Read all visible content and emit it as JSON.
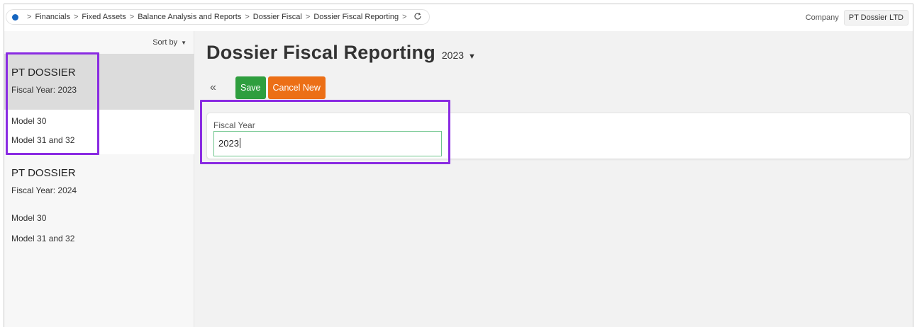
{
  "breadcrumbs": [
    "Financials",
    "Fixed Assets",
    "Balance Analysis and Reports",
    "Dossier Fiscal",
    "Dossier Fiscal Reporting"
  ],
  "breadcrumb_separator": ">",
  "company": {
    "label": "Company",
    "value": "PT Dossier LTD"
  },
  "sidebar": {
    "sort_label": "Sort by",
    "groups": [
      {
        "title": "PT DOSSIER",
        "fiscal_label": "Fiscal Year:",
        "fiscal_value": "2023",
        "items": [
          "Model 30",
          "Model 31 and 32"
        ]
      },
      {
        "title": "PT DOSSIER",
        "fiscal_label": "Fiscal Year:",
        "fiscal_value": "2024",
        "items": [
          "Model 30",
          "Model 31 and 32"
        ]
      }
    ]
  },
  "page": {
    "title": "Dossier Fiscal Reporting",
    "year": "2023"
  },
  "toolbar": {
    "collapse_symbol": "«",
    "save_label": "Save",
    "cancel_label": "Cancel New"
  },
  "form": {
    "fiscal_year_label": "Fiscal Year",
    "fiscal_year_value": "2023"
  },
  "colors": {
    "save": "#2e9e3e",
    "cancel": "#ec6f16",
    "highlight": "#8a2be2",
    "input_border": "#6cc48a",
    "selected_group": "#dcdcdc"
  },
  "icons": {
    "home_dot": "blue-dot-icon",
    "refresh": "refresh-icon",
    "sort_caret": "caret-down-icon",
    "year_caret": "caret-down-icon",
    "collapse": "double-chevron-left-icon"
  }
}
